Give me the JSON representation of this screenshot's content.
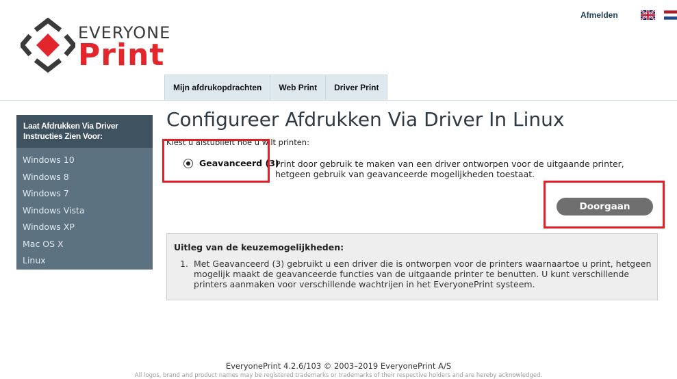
{
  "header": {
    "logo_top": "EVERYONE",
    "logo_bottom": "Print",
    "logout": "Afmelden",
    "tabs": [
      {
        "label": "Mijn afdrukopdrachten"
      },
      {
        "label": "Web Print"
      },
      {
        "label": "Driver Print"
      }
    ]
  },
  "sidebar": {
    "heading": "Laat Afdrukken Via Driver Instructies Zien Voor:",
    "items": [
      "Windows 10",
      "Windows 8",
      "Windows 7",
      "Windows Vista",
      "Windows XP",
      "Mac OS X",
      "Linux"
    ]
  },
  "main": {
    "title": "Configureer Afdrukken Via Driver In Linux",
    "instruction": "Kiest u alstublieft hoe u wilt printen:",
    "option_label": "Geavanceerd (3)",
    "option_desc": "Print door gebruik te maken van een driver ontworpen voor de uitgaande printer, hetgeen gebruik van geavanceerde mogelijkheden toestaat.",
    "continue_label": "Doorgaan",
    "explain_title": "Uitleg van de keuzemogelijkheden:",
    "explain_items": [
      {
        "num": "1.",
        "text": "Met Geavanceerd (3) gebruikt u een driver die is ontworpen voor de printers waarnaartoe u print, hetgeen mogelijk maakt de geavanceerde functies van de uitgaande printer te benutten. U kunt verschillende printers aanmaken voor verschillende wachtrijen in het EveryonePrint systeem."
      }
    ]
  },
  "footer": {
    "version": "EveryonePrint 4.2.6/103 © 2003–2019 EveryonePrint A/S",
    "legal": "All logos, brand and product names may be registered trademarks or trademarks of their respective holders and are hereby acknowledged."
  },
  "colors": {
    "brand_red": "#e2262b",
    "sidebar_bg": "#5c7280",
    "highlight": "#e02025"
  }
}
